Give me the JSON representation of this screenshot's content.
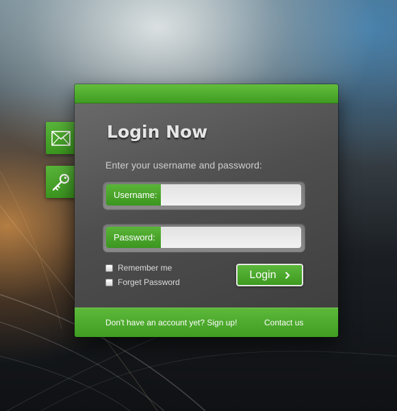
{
  "panel": {
    "title": "Login Now",
    "subtitle": "Enter your username and password:"
  },
  "username": {
    "label": "Username:",
    "value": "",
    "placeholder": ""
  },
  "password": {
    "label": "Password:",
    "value": "",
    "placeholder": ""
  },
  "options": {
    "remember": {
      "label": "Remember me",
      "checked": false
    },
    "forget": {
      "label": "Forget Password",
      "checked": false
    }
  },
  "login_button": {
    "label": "Login"
  },
  "footer": {
    "signup_label": "Don't have an account yet? Sign up!",
    "contact_label": "Contact us"
  },
  "side_tabs": [
    {
      "icon": "mail-icon"
    },
    {
      "icon": "key-icon"
    }
  ],
  "colors": {
    "accent_green": "#4aa52b",
    "panel_gray": "#555555"
  }
}
